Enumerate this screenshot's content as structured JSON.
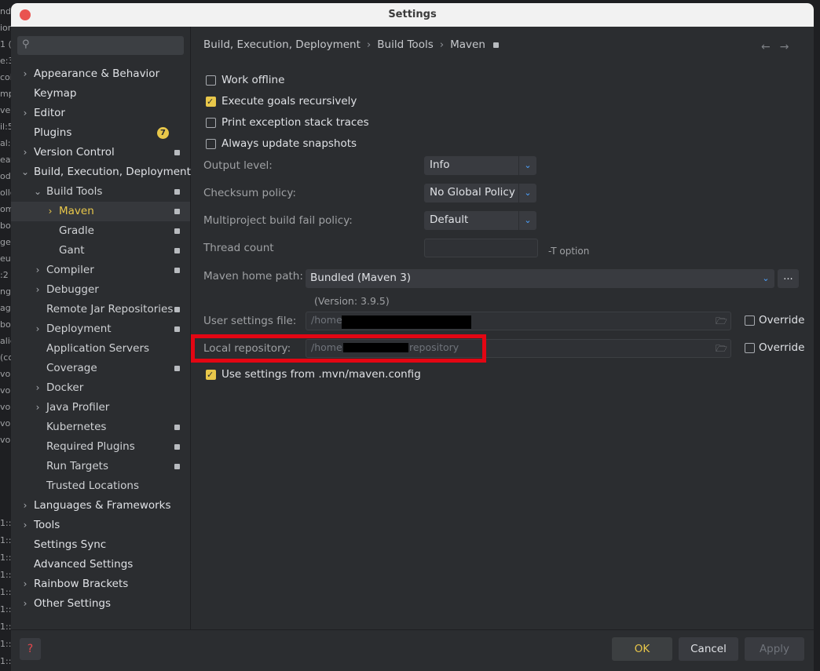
{
  "background": {
    "left_fragments": [
      "ndi",
      "ior",
      "1 (",
      "e:3",
      "coi",
      "mp",
      "ven",
      "il:5",
      "al:3",
      "eat",
      "od",
      "ollo",
      "om",
      "boc",
      "ge",
      "eu",
      ":2",
      "ng",
      "agg",
      "bo",
      "alid",
      "(co",
      "vor",
      "vor",
      "vor",
      "vor",
      "vor"
    ],
    "bottom_fragments": [
      "1::",
      "1::",
      "1::",
      "1::",
      "1::",
      "1::",
      "1::",
      "1::",
      "1::"
    ]
  },
  "window": {
    "title": "Settings"
  },
  "search": {
    "icon": "search-icon",
    "placeholder": ""
  },
  "sidebar": {
    "items": [
      {
        "label": "Appearance & Behavior",
        "chev": "›",
        "project": false
      },
      {
        "label": "Keymap",
        "chev": "",
        "project": false
      },
      {
        "label": "Editor",
        "chev": "›",
        "project": false
      },
      {
        "label": "Plugins",
        "chev": "",
        "project": false,
        "badge": "7"
      },
      {
        "label": "Version Control",
        "chev": "›",
        "project": true
      },
      {
        "label": "Build, Execution, Deployment",
        "chev": "⌄",
        "project": false
      },
      {
        "label": "Build Tools",
        "chev": "⌄",
        "project": true
      },
      {
        "label": "Maven",
        "chev": "›",
        "project": true
      },
      {
        "label": "Gradle",
        "chev": "",
        "project": true
      },
      {
        "label": "Gant",
        "chev": "",
        "project": true
      },
      {
        "label": "Compiler",
        "chev": "›",
        "project": true
      },
      {
        "label": "Debugger",
        "chev": "›",
        "project": false
      },
      {
        "label": "Remote Jar Repositories",
        "chev": "",
        "project": true
      },
      {
        "label": "Deployment",
        "chev": "›",
        "project": true
      },
      {
        "label": "Application Servers",
        "chev": "",
        "project": false
      },
      {
        "label": "Coverage",
        "chev": "",
        "project": true
      },
      {
        "label": "Docker",
        "chev": "›",
        "project": false
      },
      {
        "label": "Java Profiler",
        "chev": "›",
        "project": false
      },
      {
        "label": "Kubernetes",
        "chev": "",
        "project": true
      },
      {
        "label": "Required Plugins",
        "chev": "",
        "project": true
      },
      {
        "label": "Run Targets",
        "chev": "",
        "project": true
      },
      {
        "label": "Trusted Locations",
        "chev": "",
        "project": false
      },
      {
        "label": "Languages & Frameworks",
        "chev": "›",
        "project": false
      },
      {
        "label": "Tools",
        "chev": "›",
        "project": false
      },
      {
        "label": "Settings Sync",
        "chev": "",
        "project": false
      },
      {
        "label": "Advanced Settings",
        "chev": "",
        "project": false
      },
      {
        "label": "Rainbow Brackets",
        "chev": "›",
        "project": false
      },
      {
        "label": "Other Settings",
        "chev": "›",
        "project": false
      }
    ]
  },
  "breadcrumb": {
    "part1": "Build, Execution, Deployment",
    "part2": "Build Tools",
    "part3": "Maven",
    "separator": "›"
  },
  "nav": {
    "back": "←",
    "forward": "→"
  },
  "maven": {
    "work_offline": {
      "label": "Work offline",
      "checked": false
    },
    "execute_goals": {
      "label": "Execute goals recursively",
      "checked": true
    },
    "print_exception": {
      "label": "Print exception stack traces",
      "checked": false
    },
    "always_update": {
      "label": "Always update snapshots",
      "checked": false
    },
    "output_level": {
      "label": "Output level:",
      "value": "Info"
    },
    "checksum_policy": {
      "label": "Checksum policy:",
      "value": "No Global Policy"
    },
    "fail_policy": {
      "label": "Multiproject build fail policy:",
      "value": "Default"
    },
    "thread_count": {
      "label": "Thread count",
      "value": "",
      "hint": "-T option"
    },
    "home_path": {
      "label": "Maven home path:",
      "value": "Bundled (Maven 3)",
      "browse": "...",
      "version": "(Version: 3.9.5)"
    },
    "user_settings": {
      "label": "User settings file:",
      "value": "/home",
      "override": "Override"
    },
    "local_repo": {
      "label": "Local repository:",
      "value_start": "/home",
      "value_end": "repository",
      "override": "Override"
    },
    "use_mvn_config": {
      "label": "Use settings from .mvn/maven.config",
      "checked": true
    }
  },
  "footer": {
    "help": "?",
    "ok": "OK",
    "cancel": "Cancel",
    "apply": "Apply"
  },
  "colors": {
    "accent": "#e8c74a",
    "highlight": "#e30613",
    "link_blue": "#4da3ff"
  }
}
